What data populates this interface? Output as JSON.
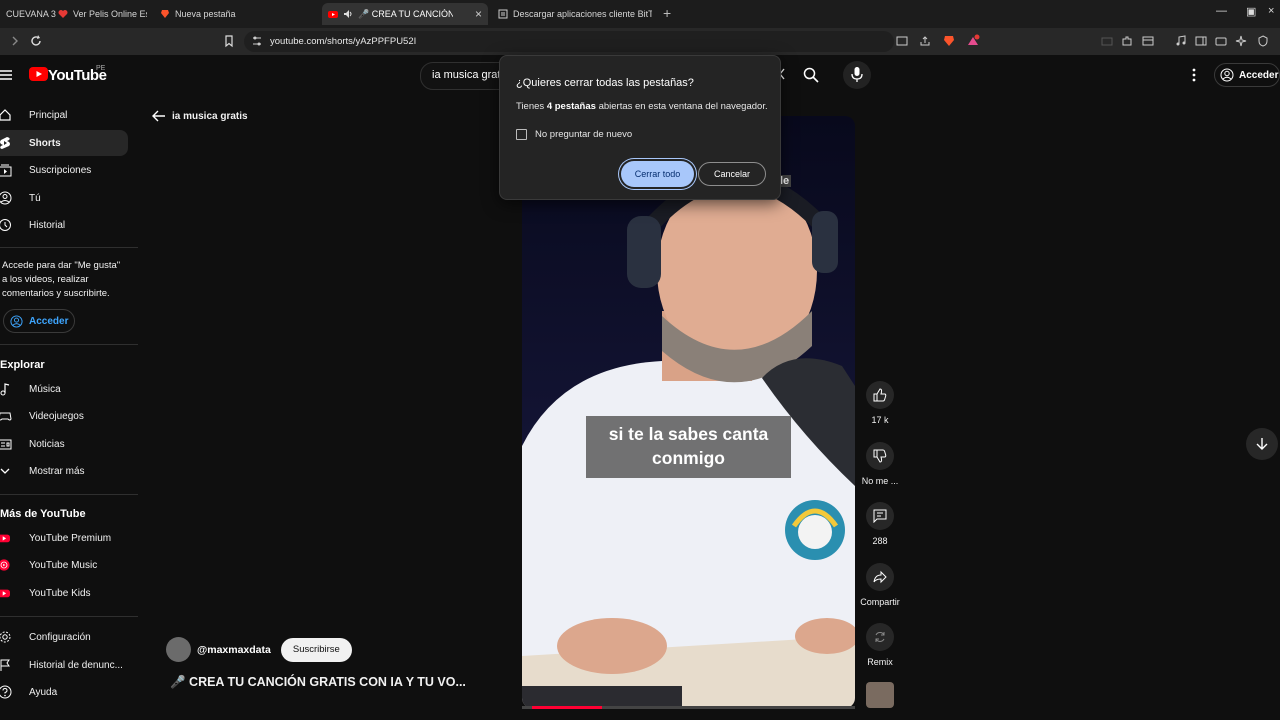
{
  "browser": {
    "tabs": [
      {
        "label": "CUEVANA 3"
      },
      {
        "label": "Ver Pelis Online Estr..."
      },
      {
        "label": "Nueva pestaña"
      },
      {
        "label": "🎤 CREA TU CANCIÓN GRATI"
      },
      {
        "label": "Descargar aplicaciones cliente BitTorr"
      }
    ],
    "new_tab": "+",
    "url": "youtube.com/shorts/yAzPPFPU52I"
  },
  "youtube": {
    "logo": "YouTube",
    "country": "PE",
    "search_value": "ia musica grat",
    "signin_label": "Acceder"
  },
  "sidebar": {
    "items": [
      {
        "label": "Principal",
        "icon": "home-icon"
      },
      {
        "label": "Shorts",
        "icon": "shorts-icon"
      },
      {
        "label": "Suscripciones",
        "icon": "subscriptions-icon"
      },
      {
        "label": "Tú",
        "icon": "you-icon"
      },
      {
        "label": "Historial",
        "icon": "history-icon"
      }
    ],
    "signin_message": "Accede para dar \"Me gusta\" a los videos, realizar comentarios y suscribirte.",
    "signin_button": "Acceder",
    "explore_title": "Explorar",
    "explore": [
      {
        "label": "Música",
        "icon": "music-icon"
      },
      {
        "label": "Videojuegos",
        "icon": "gaming-icon"
      },
      {
        "label": "Noticias",
        "icon": "news-icon"
      },
      {
        "label": "Mostrar más",
        "icon": "chevron-down-icon"
      }
    ],
    "more_title": "Más de YouTube",
    "more": [
      {
        "label": "YouTube Premium"
      },
      {
        "label": "YouTube Music"
      },
      {
        "label": "YouTube Kids"
      }
    ],
    "bottom": [
      {
        "label": "Configuración",
        "icon": "gear-icon"
      },
      {
        "label": "Historial de denunc...",
        "icon": "flag-icon"
      },
      {
        "label": "Ayuda",
        "icon": "help-icon"
      }
    ]
  },
  "main": {
    "back_label": "ia musica gratis",
    "caption": "si te la sabes canta conmigo",
    "partial_caption": "le",
    "channel": "@maxmaxdata",
    "subscribe": "Suscribirse",
    "title": "🎤 CREA TU CANCIÓN GRATIS CON IA Y TU VO...",
    "progress_fraction": 0.21,
    "controls": {
      "likes": "17 k",
      "dislike": "No me ...",
      "comments": "288",
      "share": "Compartir",
      "remix": "Remix"
    }
  },
  "dialog": {
    "title": "¿Quieres cerrar todas las pestañas?",
    "body_prefix": "Tienes ",
    "body_bold": "4 pestañas",
    "body_suffix": " abiertas en esta ventana del navegador.",
    "checkbox_label": "No preguntar de nuevo",
    "confirm": "Cerrar todo",
    "cancel": "Cancelar"
  }
}
